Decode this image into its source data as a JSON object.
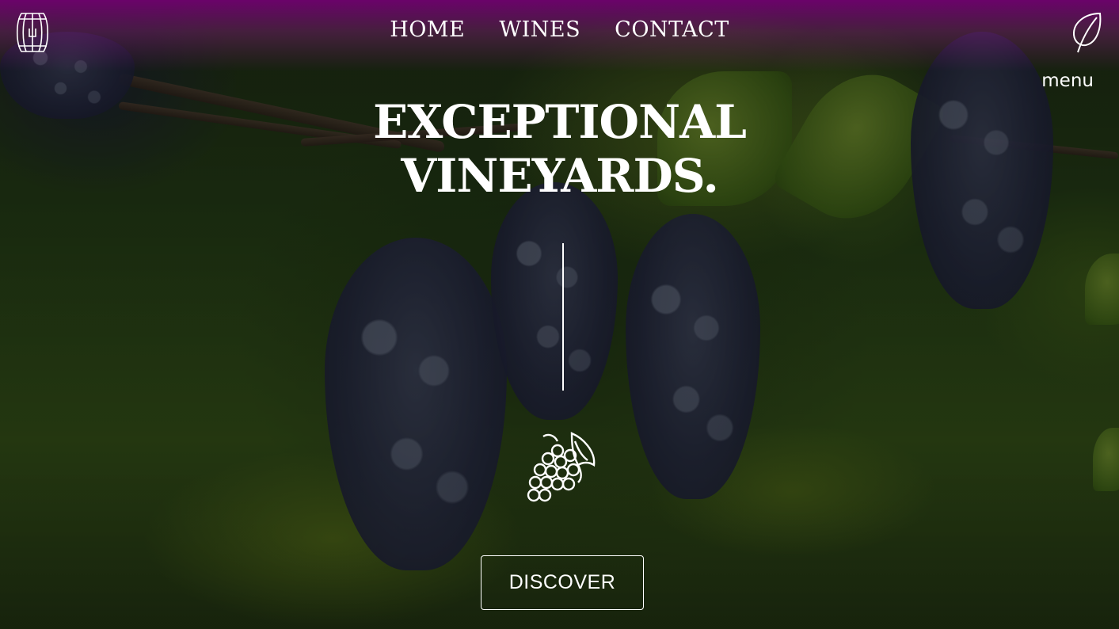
{
  "header": {
    "logo_icon": "wine-barrel-icon",
    "nav": [
      {
        "label": "HOME"
      },
      {
        "label": "WINES"
      },
      {
        "label": "CONTACT"
      }
    ],
    "leaf_icon": "leaf-icon",
    "menu_label": "menu"
  },
  "hero": {
    "headline_line1": "EXCEPTIONAL",
    "headline_line2": "VINEYARDS.",
    "decor_icon": "grapes-icon",
    "cta_label": "DISCOVER",
    "background": "vineyard-grapes-photo",
    "top_tint_color": "#6e006e",
    "text_color": "#ffffff"
  }
}
